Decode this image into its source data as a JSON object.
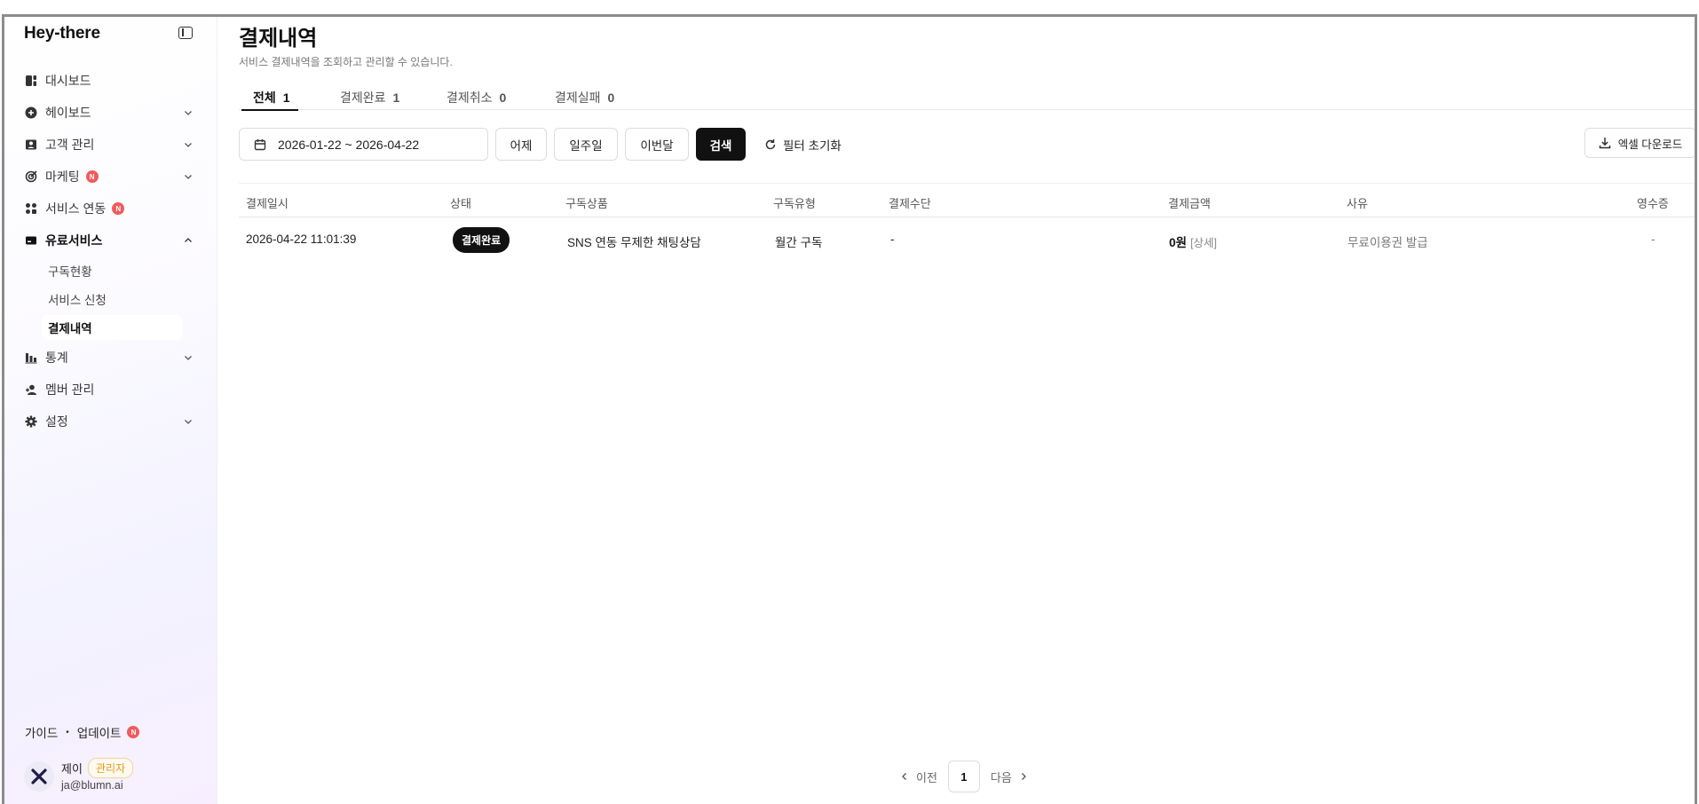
{
  "sidebar": {
    "brand": "Hey-there",
    "items": [
      {
        "label": "대시보드",
        "icon": "dashboard-icon"
      },
      {
        "label": "헤이보드",
        "icon": "plus-circle-icon"
      },
      {
        "label": "고객 관리",
        "icon": "user-card-icon"
      },
      {
        "label": "마케팅",
        "icon": "marketing-icon",
        "badge": "N"
      },
      {
        "label": "서비스 연동",
        "icon": "apps-icon",
        "badge": "N"
      },
      {
        "label": "유료서비스",
        "icon": "card-icon"
      },
      {
        "label": "통계",
        "icon": "stats-icon"
      },
      {
        "label": "멤버 관리",
        "icon": "members-icon"
      },
      {
        "label": "설정",
        "icon": "gear-icon"
      }
    ],
    "sub_items": [
      "구독현황",
      "서비스 신청",
      "결제내역"
    ],
    "guide": "가이드",
    "update": "업데이트",
    "update_badge": "N",
    "user": {
      "name": "제이",
      "role": "관리자",
      "email": "ja@blumn.ai"
    }
  },
  "main": {
    "title": "결제내역",
    "description": "서비스 결제내역을 조회하고 관리할 수 있습니다.",
    "tabs": [
      {
        "label": "전체",
        "count": "1"
      },
      {
        "label": "결제완료",
        "count": "1"
      },
      {
        "label": "결제취소",
        "count": "0"
      },
      {
        "label": "결제실패",
        "count": "0"
      }
    ],
    "filters": {
      "date_range": "2026-01-22 ~ 2026-04-22",
      "yesterday": "어제",
      "week": "일주일",
      "this_month": "이번달",
      "search": "검색",
      "reset": "필터 초기화",
      "excel": "엑셀 다운로드"
    },
    "table": {
      "headers": [
        "결제일시",
        "상태",
        "구독상품",
        "구독유형",
        "결제수단",
        "결제금액",
        "사유",
        "영수증"
      ],
      "rows": [
        {
          "date": "2026-04-22 11:01:39",
          "status": "결제완료",
          "product": "SNS 연동 무제한 채팅상담",
          "type": "월간 구독",
          "method": "-",
          "amount": "0원",
          "detail": "[상세]",
          "reason": "무료이용권 발급",
          "receipt": "-"
        }
      ]
    },
    "pagination": {
      "prev": "이전",
      "page": "1",
      "next": "다음"
    }
  }
}
